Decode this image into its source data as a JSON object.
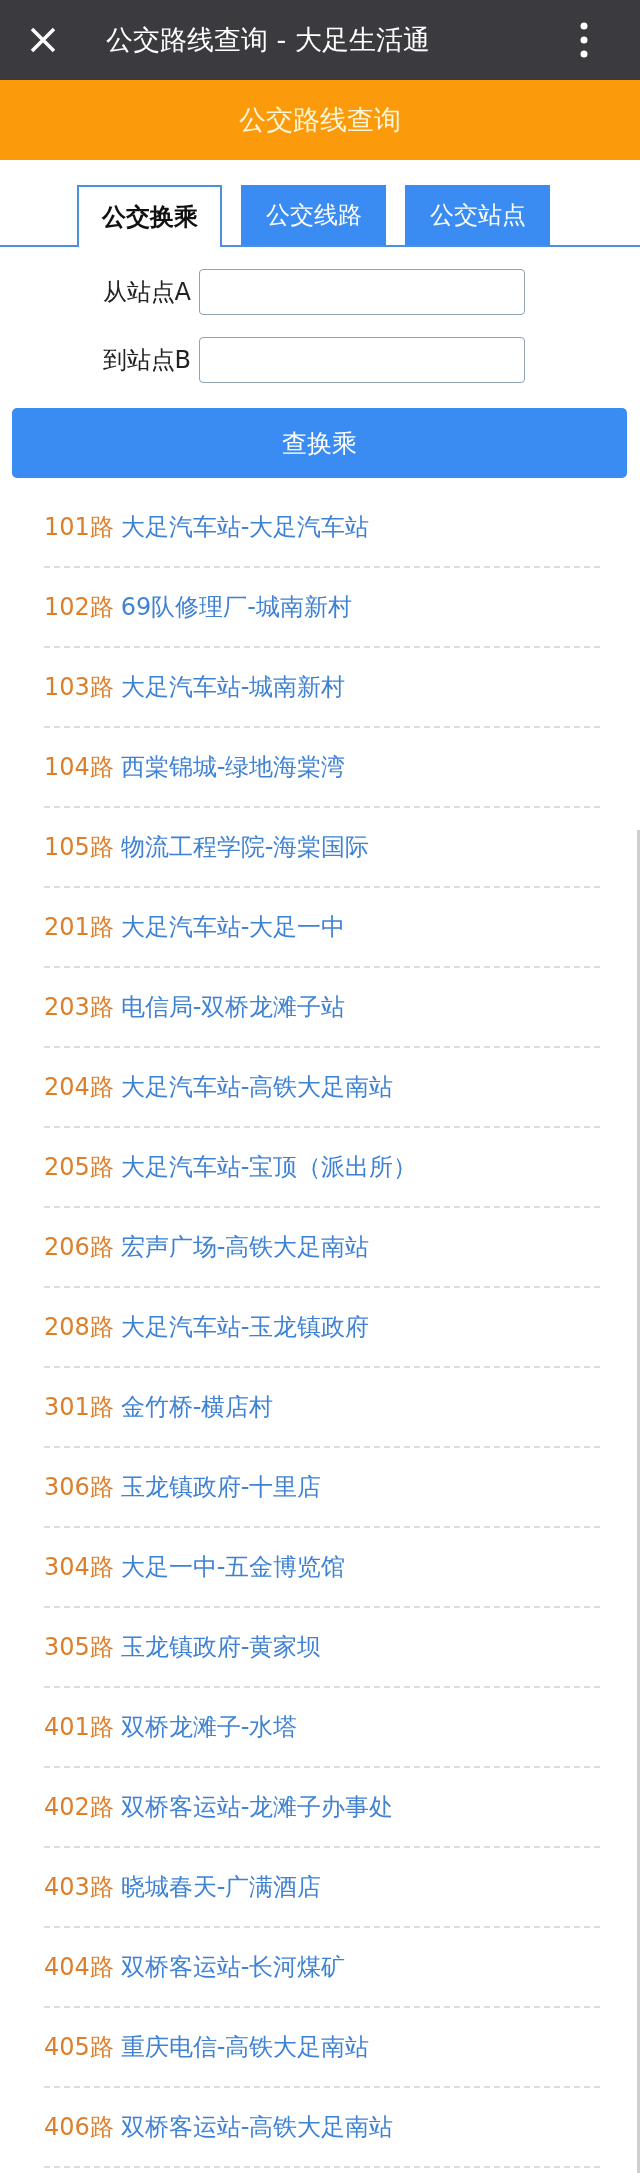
{
  "window": {
    "title": "公交路线查询 - 大足生活通"
  },
  "header": {
    "title": "公交路线查询"
  },
  "tabs": [
    {
      "label": "公交换乘",
      "selected": true
    },
    {
      "label": "公交线路",
      "selected": false
    },
    {
      "label": "公交站点",
      "selected": false
    }
  ],
  "form": {
    "fields": [
      {
        "label": "从站点A"
      },
      {
        "label": "到站点B"
      }
    ],
    "button": "查换乘"
  },
  "routes": [
    {
      "number": "101路",
      "name": "大足汽车站-大足汽车站"
    },
    {
      "number": "102路",
      "name": "69队修理厂-城南新村"
    },
    {
      "number": "103路",
      "name": "大足汽车站-城南新村"
    },
    {
      "number": "104路",
      "name": "西棠锦城-绿地海棠湾"
    },
    {
      "number": "105路",
      "name": "物流工程学院-海棠国际"
    },
    {
      "number": "201路",
      "name": "大足汽车站-大足一中"
    },
    {
      "number": "203路",
      "name": "电信局-双桥龙滩子站"
    },
    {
      "number": "204路",
      "name": "大足汽车站-高铁大足南站"
    },
    {
      "number": "205路",
      "name": "大足汽车站-宝顶（派出所）"
    },
    {
      "number": "206路",
      "name": "宏声广场-高铁大足南站"
    },
    {
      "number": "208路",
      "name": "大足汽车站-玉龙镇政府"
    },
    {
      "number": "301路",
      "name": "金竹桥-横店村"
    },
    {
      "number": "306路",
      "name": "玉龙镇政府-十里店"
    },
    {
      "number": "304路",
      "name": "大足一中-五金博览馆"
    },
    {
      "number": "305路",
      "name": "玉龙镇政府-黄家坝"
    },
    {
      "number": "401路",
      "name": "双桥龙滩子-水塔"
    },
    {
      "number": "402路",
      "name": "双桥客运站-龙滩子办事处"
    },
    {
      "number": "403路",
      "name": "晓城春天-广满酒店"
    },
    {
      "number": "404路",
      "name": "双桥客运站-长河煤矿"
    },
    {
      "number": "405路",
      "name": "重庆电信-高铁大足南站"
    },
    {
      "number": "406路",
      "name": "双桥客运站-高铁大足南站"
    }
  ]
}
